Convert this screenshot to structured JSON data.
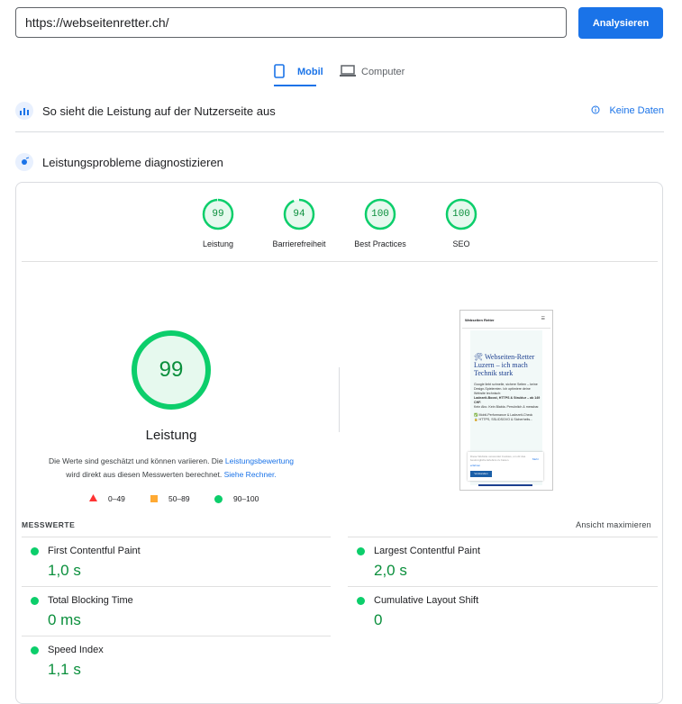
{
  "search": {
    "url": "https://webseitenretter.ch/",
    "button": "Analysieren"
  },
  "tabs": [
    {
      "label": "Mobil"
    },
    {
      "label": "Computer"
    }
  ],
  "field_data": {
    "title": "So sieht die Leistung auf der Nutzerseite aus",
    "status": "Keine Daten"
  },
  "diagnose": {
    "title": "Leistungsprobleme diagnostizieren"
  },
  "scores": [
    {
      "value": "99",
      "label": "Leistung",
      "fraction": 0.99
    },
    {
      "value": "94",
      "label": "Barrierefreiheit",
      "fraction": 0.94
    },
    {
      "value": "100",
      "label": "Best Practices",
      "fraction": 1.0
    },
    {
      "value": "100",
      "label": "SEO",
      "fraction": 1.0
    }
  ],
  "main_score": {
    "value": "99",
    "label": "Leistung",
    "note_pre": "Die Werte sind geschätzt und können variieren. Die ",
    "note_link1": "Leistungsbewertung",
    "note_mid": "wird direkt aus diesen Messwerten berechnet. ",
    "note_link2": "Siehe Rechner."
  },
  "legend": [
    {
      "range": "0–49",
      "color": "#ff3333"
    },
    {
      "range": "50–89",
      "color": "#ffaa33"
    },
    {
      "range": "90–100",
      "color": "#0cce6b"
    }
  ],
  "metrics_header": {
    "title": "MESSWERTE",
    "toggle": "Ansicht maximieren"
  },
  "metrics": [
    {
      "name": "First Contentful Paint",
      "value": "1,0 s"
    },
    {
      "name": "Largest Contentful Paint",
      "value": "2,0 s"
    },
    {
      "name": "Total Blocking Time",
      "value": "0 ms"
    },
    {
      "name": "Cumulative Layout Shift",
      "value": "0"
    },
    {
      "name": "Speed Index",
      "value": "1,1 s"
    }
  ],
  "preview": {
    "brand": "Webseiten Retter",
    "menu": "☰",
    "headline": "🛠 Webseiten-Retter Luzern – ich mach Technik stark",
    "body1": "Google liebt schnelle, sichere Seiten – keine Design-Spielereien. Ich optimiere deine Website technisch:",
    "body2": "Ladezeit-Boost, HTTPS & Struktur – ab 149 CHF.",
    "body3": "Kein Abo. Kein Blabla. Persönlich & messbar.",
    "check1": "✅ Mobil-Performance & Ladezeit-Check",
    "check2": "🔒 HTTPS, SSL/DSGVO & Sicherheits...",
    "cookie_text": "Diese Website verwendet Cookies, um dir das bestmögliche Erlebnis zu bieten.",
    "cookie_link": "Mehr",
    "cookie_link2": "erfahren",
    "cookie_button": "Verstanden"
  },
  "colors": {
    "accent": "#1a73e8",
    "pass": "#0cce6b",
    "pass_text": "#0a8f3c"
  }
}
